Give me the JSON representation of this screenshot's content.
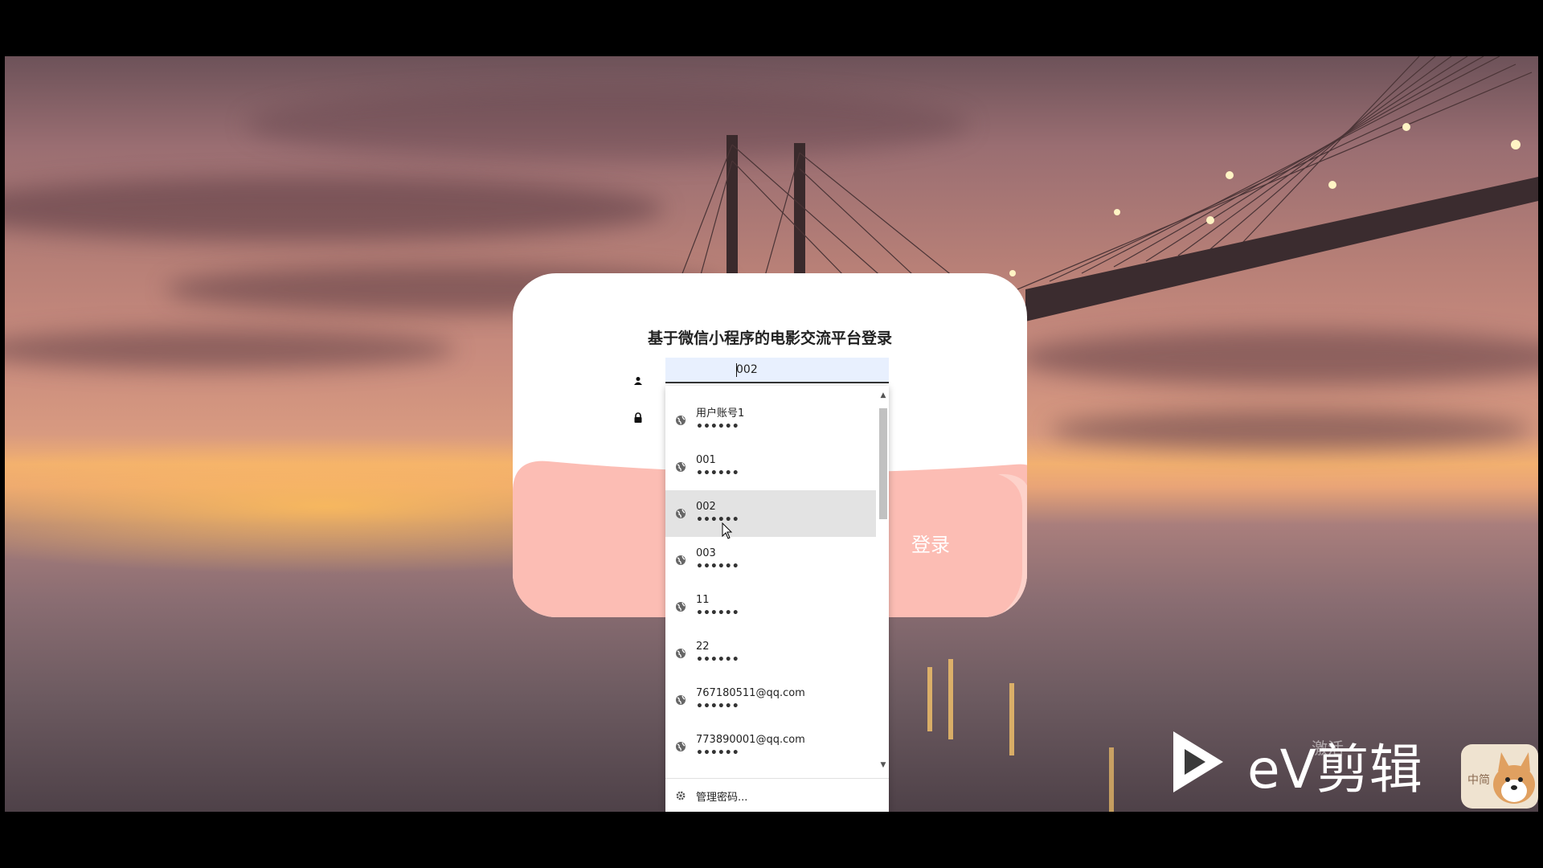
{
  "login": {
    "title": "基于微信小程序的电影交流平台登录",
    "username_value": "002",
    "button_label": "登录"
  },
  "autocomplete": {
    "items": [
      {
        "user": "用户账号1",
        "pass": "••••••"
      },
      {
        "user": "001",
        "pass": "••••••"
      },
      {
        "user": "002",
        "pass": "••••••"
      },
      {
        "user": "003",
        "pass": "••••••"
      },
      {
        "user": "11",
        "pass": "••••••"
      },
      {
        "user": "22",
        "pass": "••••••"
      },
      {
        "user": "767180511@qq.com",
        "pass": "••••••"
      },
      {
        "user": "773890001@qq.com",
        "pass": "••••••"
      }
    ],
    "hovered_index": 2,
    "manage_label": "管理密码..."
  },
  "watermark": {
    "brand": "eV剪辑",
    "activate_text": "激活",
    "badge": "中简"
  },
  "colors": {
    "accent_pink": "#fcbdb4",
    "input_bg": "#e8f0fe"
  }
}
